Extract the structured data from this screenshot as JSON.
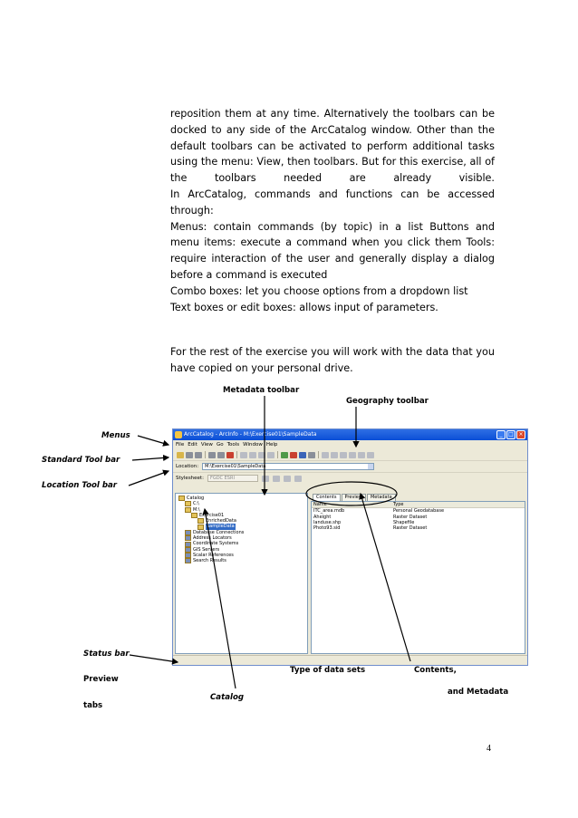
{
  "body": {
    "para1": [
      "reposition them at any time. Alternatively the toolbars can be docked to any side of the ArcCatalog window. Other than the default toolbars can be activated to perform additional tasks using the menu: View, then toolbars. But for this exercise, all of the toolbars needed are already visible.",
      "In ArcCatalog, commands and functions can be accessed through:",
      "Menus: contain commands (by topic) in a list Buttons and menu items: execute a command when you click them Tools: require interaction of the user and generally display a dialog before a command is executed",
      "Combo boxes: let you choose options from a dropdown list",
      "Text boxes or edit boxes: allows input of parameters."
    ],
    "para2": "For the rest of the exercise you will work with the data that you have copied on your personal drive."
  },
  "labels": {
    "metadata_toolbar": "Metadata toolbar",
    "geography_toolbar": "Geography toolbar",
    "menus": "Menus",
    "standard_toolbar": "Standard Tool bar",
    "location_toolbar": "Location Tool bar",
    "status_bar": "Status bar",
    "preview": "Preview",
    "tabs": "tabs",
    "catalog": "Catalog",
    "type_of_data_sets": "Type of data sets",
    "contents": "Contents,",
    "and_metadata": "and Metadata"
  },
  "page_number": "4",
  "screenshot": {
    "title": "ArcCatalog - ArcInfo - M:\\Exercise01\\SampleData",
    "menu": [
      "File",
      "Edit",
      "View",
      "Go",
      "Tools",
      "Window",
      "Help"
    ],
    "location_label": "Location:",
    "location_value": "M:\\Exercise01\\SampleData",
    "stylesheet_label": "Stylesheet:",
    "stylesheet_value": "FGDC ESRI",
    "tree": [
      {
        "label": "Catalog",
        "indent": 0
      },
      {
        "label": "C:\\",
        "indent": 1
      },
      {
        "label": "M:\\",
        "indent": 1
      },
      {
        "label": "Exercise01",
        "indent": 2
      },
      {
        "label": "EnrichedData",
        "indent": 3
      },
      {
        "label": "SampleData",
        "indent": 3,
        "selected": true
      },
      {
        "label": "Database Connections",
        "indent": 1
      },
      {
        "label": "Address Locators",
        "indent": 1
      },
      {
        "label": "Coordinate Systems",
        "indent": 1
      },
      {
        "label": "GIS Servers",
        "indent": 1
      },
      {
        "label": "Scalar References",
        "indent": 1
      },
      {
        "label": "Search Results",
        "indent": 1
      }
    ],
    "tabs": [
      "Contents",
      "Preview",
      "Metadata"
    ],
    "columns": [
      "Name",
      "Type"
    ],
    "rows": [
      [
        "ITC_area.mdb",
        "Personal Geodatabase"
      ],
      [
        "Aheight",
        "Raster Dataset"
      ],
      [
        "landuse.shp",
        "Shapefile"
      ],
      [
        "Photo93.sid",
        "Raster Dataset"
      ]
    ]
  }
}
